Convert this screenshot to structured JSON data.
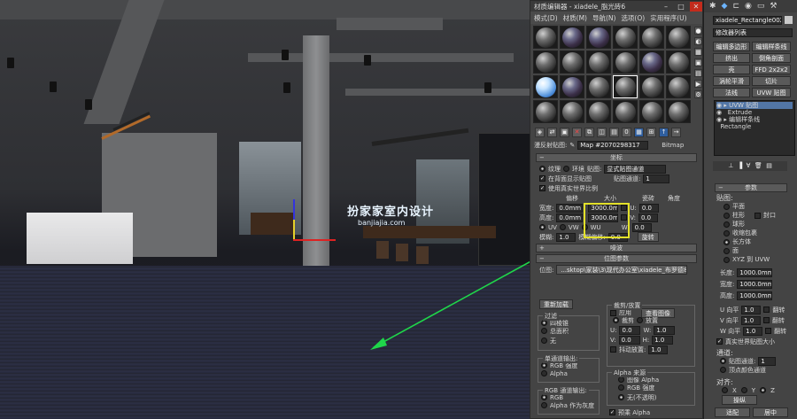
{
  "viewport": {
    "watermark_main": "扮家家室内设计",
    "watermark_sub": "banjiajia.com"
  },
  "material_editor": {
    "title": "材质编辑器 - xiadele_脂光砖6",
    "menus": [
      "模式(D)",
      "材质(M)",
      "导航(N)",
      "选项(O)",
      "实用程序(U)"
    ],
    "map_name_label": "漫反射贴图:",
    "map_name_value": "Map #2070298317",
    "map_type": "Bitmap",
    "coordinates": {
      "title": "坐标",
      "texture_label": "纹理",
      "environ_label": "环境",
      "mapping_label": "贴图:",
      "mapping_value": "显式贴图通道",
      "show_back_label": "在背面显示贴图",
      "map_channel_label": "贴图通道:",
      "map_channel_value": "1",
      "use_realworld_label": "使用真实世界比例",
      "offset_label": "偏移",
      "size_label": "大小",
      "tiling_label": "瓷砖",
      "angle_label": "角度",
      "width_label": "宽度:",
      "height_label": "高度:",
      "offset_w": "0.0mm",
      "offset_h": "0.0mm",
      "size_w": "3000.0m",
      "size_h": "3000.0m",
      "u_label": "U:",
      "v_label": "V:",
      "w_label": "W:",
      "angle_u": "0.0",
      "angle_v": "0.0",
      "angle_w": "0.0",
      "uv_label": "UV",
      "vw_label": "VW",
      "wu_label": "WU",
      "blur_label": "模糊:",
      "blur_value": "1.0",
      "blur_offset_label": "模糊偏移:",
      "blur_offset_value": "0.0",
      "rotate_label": "旋转"
    },
    "noise_title": "噪波",
    "bitmap_params": {
      "title": "位图参数",
      "bitmap_label": "位图:",
      "bitmap_path": "...sktop\\家装\\3\\现代办公室\\xiadele_布罗德8-1.jpg",
      "reload_label": "重新加载",
      "crop_group": "裁剪/放置",
      "apply_label": "应用",
      "view_image_label": "查看图像",
      "crop_label": "裁剪",
      "place_label": "放置",
      "filter_group": "过滤",
      "filter_options": [
        "四棱锥",
        "总面积",
        "无"
      ],
      "u_label": "U:",
      "v_label": "V:",
      "w_label": "W:",
      "h_label": "H:",
      "u_val": "0.0",
      "v_val": "0.0",
      "w_val": "1.0",
      "h_val": "1.0",
      "jitter_label": "抖动放置:",
      "jitter_val": "1.0",
      "mono_group": "单通道输出:",
      "mono_options": [
        "RGB 强度",
        "Alpha"
      ],
      "rgb_group": "RGB 通道输出:",
      "rgb_options": [
        "RGB",
        "Alpha 作为灰度"
      ],
      "alpha_group": "Alpha 来源",
      "alpha_options": [
        "图像 Alpha",
        "RGB 强度",
        "无(不透明)"
      ],
      "premult_label": "预乘 Alpha"
    }
  },
  "command_panel": {
    "object_name": "xiadele_Rectangle002",
    "modifier_list": "修改器列表",
    "buttons": [
      "编辑多边形",
      "编辑样条线",
      "挤出",
      "倒角剖面",
      "壳",
      "FFD 2x2x2",
      "涡轮平滑",
      "切片",
      "法线",
      "UVW 贴图"
    ],
    "stack": [
      "UVW 贴图",
      "Extrude",
      "编辑样条线",
      "Rectangle"
    ],
    "params_title": "参数",
    "mapping_title": "贴图:",
    "mapping_options": [
      "平面",
      "柱形",
      "球形",
      "收缩包裹",
      "长方体",
      "面",
      "XYZ 到 UVW"
    ],
    "cap_label": "封口",
    "length_label": "长度:",
    "width_label": "宽度:",
    "height_label": "高度:",
    "length_val": "1000.0mm",
    "width_val": "1000.0mm",
    "height_val": "1000.0mm",
    "u_tile_label": "U 向平",
    "v_tile_label": "V 向平",
    "w_tile_label": "W 向平",
    "tile_val": "1.0",
    "flip_label": "翻转",
    "realworld_label": "真实世界贴图大小",
    "channel_title": "通道:",
    "channel_map_label": "贴图通道:",
    "channel_map_val": "1",
    "vertex_color_label": "顶点颜色通道",
    "align_title": "对齐:",
    "align_axes": [
      "X",
      "Y",
      "Z"
    ],
    "operate_label": "操纵",
    "fit_label": "适配",
    "center_label": "居中"
  },
  "colors": {
    "highlight_box": "#e3e12a",
    "arrow": "#1fd64a",
    "selected_stack": "#5276a6"
  }
}
